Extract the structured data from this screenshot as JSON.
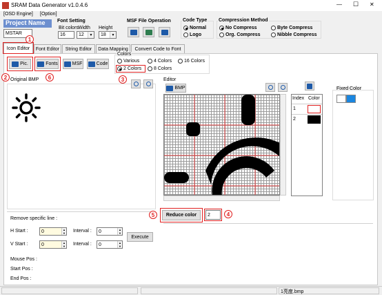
{
  "window": {
    "title": "SRAM Data Generator v1.0.4.6",
    "controls": {
      "minimize": "—",
      "maximize": "☐",
      "close": "✕"
    }
  },
  "menu": [
    "[OSD Engine]",
    "[Option]"
  ],
  "project": {
    "label": "Project Name",
    "value": "MSTAR"
  },
  "font_setting": {
    "title": "Font Setting",
    "bit_colors_label": "Bit colors",
    "bit_colors_value": "16",
    "width_label": "Width",
    "width_value": "12",
    "height_label": "Height",
    "height_value": "18"
  },
  "msf_file_operation": {
    "title": "MSF File Operation"
  },
  "code_type": {
    "title": "Code Type",
    "options": [
      "Normal",
      "Logo"
    ],
    "selected": "Normal"
  },
  "compression": {
    "title": "Compression Method",
    "options": [
      "No Compress",
      "Byte Compress",
      "Org. Compress",
      "Nibble Compress"
    ],
    "selected": "No Compress"
  },
  "tabs": [
    "Icon Editor",
    "Font Editor",
    "String Editor",
    "Data Mapping",
    "Convert Code to Font"
  ],
  "toolbar": {
    "pic": "Pic.",
    "fonts": "Fonts",
    "msf": "MSF",
    "code": "Code"
  },
  "colors": {
    "title": "Colors",
    "options": [
      "Various",
      "4 Colors",
      "16 Colors",
      "2 Colors",
      "8 Colors"
    ],
    "selected": "2 Colors"
  },
  "original_bmp": {
    "label": "Original BMP"
  },
  "editor": {
    "label": "Editor",
    "bmp_button": "BMP"
  },
  "palette": {
    "headers": [
      "Index",
      "Color"
    ],
    "rows": [
      {
        "index": "1",
        "color": "#ffffff"
      },
      {
        "index": "2",
        "color": "#000000"
      }
    ]
  },
  "fixed_color": {
    "label": "Fixed Color",
    "swatches": [
      "#ffffff",
      "#1a86e0"
    ]
  },
  "reduce": {
    "button": "Reduce color",
    "value": "2"
  },
  "remove_line": {
    "title": "Remove specific line :",
    "h_start_label": "H Start :",
    "h_start_value": "0",
    "v_start_label": "V Start :",
    "v_start_value": "0",
    "interval_label": "Interval :",
    "interval_h_value": "0",
    "interval_v_value": "0",
    "execute": "Execute"
  },
  "status": {
    "mouse_pos": "Mouse Pos :",
    "start_pos": "Start Pos :",
    "end_pos": "End Pos :",
    "file": "1亮度.bmp"
  },
  "callouts": [
    "1",
    "2",
    "3",
    "4",
    "5",
    "6"
  ],
  "accent": "#e02020"
}
